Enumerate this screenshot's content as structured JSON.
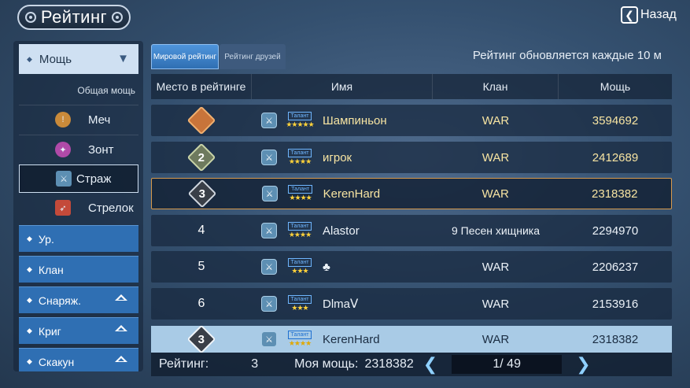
{
  "header": {
    "title": "Рейтинг",
    "back_label": "Назад"
  },
  "sidebar": {
    "active_category": "Мощь",
    "sub_label": "Общая мощь",
    "sub_items": [
      {
        "label": "Меч",
        "color": "#c98a3a"
      },
      {
        "label": "Зонт",
        "color": "#b04aa8"
      },
      {
        "label": "Страж",
        "color": "#5d8fb3"
      },
      {
        "label": "Стрелок",
        "color": "#c44a3a"
      }
    ],
    "nav_items": [
      "Ур.",
      "Клан",
      "Снаряж.",
      "Криг",
      "Скакун"
    ]
  },
  "tabs": {
    "world": "Мировой рейтинг",
    "friends": "Рейтинг друзей"
  },
  "refresh_note": "Рейтинг обновляется каждые 10 м",
  "table": {
    "headers": [
      "Место в рейтинге",
      "Имя",
      "Клан",
      "Мощь"
    ],
    "talent_label": "Талант",
    "rows": [
      {
        "rank": "1",
        "name": "Шампиньон",
        "stars": "★★★★★",
        "clan": "WAR",
        "power": "3594692"
      },
      {
        "rank": "2",
        "name": "игрок",
        "stars": "★★★★",
        "clan": "WAR",
        "power": "2412689"
      },
      {
        "rank": "3",
        "name": "KerenHard",
        "stars": "★★★★",
        "clan": "WAR",
        "power": "2318382"
      },
      {
        "rank": "4",
        "name": "Alastor",
        "stars": "★★★★",
        "clan": "9 Песен хищника",
        "power": "2294970"
      },
      {
        "rank": "5",
        "name": "♣",
        "stars": "★★★",
        "clan": "WAR",
        "power": "2206237"
      },
      {
        "rank": "6",
        "name": "Dlmaᐯ",
        "stars": "★★★",
        "clan": "WAR",
        "power": "2153916"
      }
    ]
  },
  "my_row": {
    "rank": "3",
    "name": "KerenHard",
    "stars": "★★★★",
    "clan": "WAR",
    "power": "2318382"
  },
  "footer": {
    "rating_label": "Рейтинг:",
    "rating_value": "3",
    "power_label": "Моя мощь:",
    "power_value": "2318382",
    "page": "1/ 49"
  },
  "colors": {
    "gold": "#f7e4a2",
    "accent_blue": "#2f6fb3",
    "my_row_bg": "#a9cbe6"
  }
}
